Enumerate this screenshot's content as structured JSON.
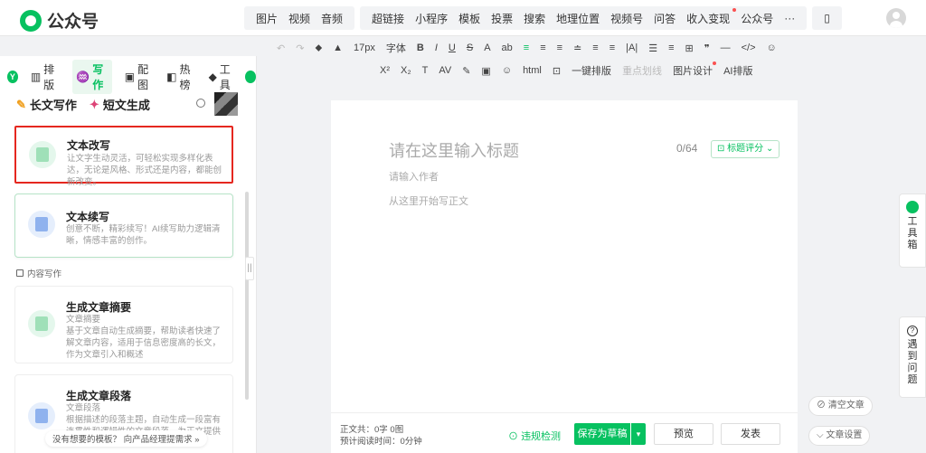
{
  "app": {
    "name": "公众号"
  },
  "top_menu": {
    "group1": [
      "图片",
      "视频",
      "音频"
    ],
    "group2": [
      "超链接",
      "小程序",
      "模板",
      "投票",
      "搜索",
      "地理位置",
      "视频号",
      "问答",
      "收入变现",
      "公众号",
      "···"
    ]
  },
  "toolbar": {
    "row1": [
      "↶",
      "↷",
      "⬥",
      "▲",
      "17px",
      "字体",
      "B",
      "I",
      "U",
      "S",
      "A",
      "ab",
      "≡",
      "≡",
      "≡",
      "≐",
      "≡",
      "≡",
      "|A|",
      "☰",
      "≡",
      "⊞",
      "❞",
      "—",
      "</>",
      "☺"
    ],
    "row2": [
      "X²",
      "X₂",
      "T",
      "AV",
      "✎",
      "▣",
      "☺",
      "html",
      "⊡",
      "一键排版",
      "重点划线",
      "图片设计",
      "AI排版"
    ]
  },
  "sidebar": {
    "tabs": [
      {
        "icon": "Y",
        "label": ""
      },
      {
        "icon": "▥",
        "label": "排版"
      },
      {
        "icon": "♒",
        "label": "写作"
      },
      {
        "icon": "▣",
        "label": "配图"
      },
      {
        "icon": "◧",
        "label": "热榜"
      },
      {
        "icon": "◆",
        "label": "工具"
      }
    ],
    "subnav": [
      "长文写作",
      "短文生成"
    ],
    "section_label": "内容写作",
    "cards": [
      {
        "title": "文本改写",
        "desc": "让文字生动灵活，可轻松实现多样化表达，无论是风格、形式还是内容，都能创新改变。"
      },
      {
        "title": "文本续写",
        "desc": "创意不断，精彩续写！AI续写助力逻辑清晰，情感丰富的创作。"
      },
      {
        "title": "生成文章摘要",
        "desc": "文章摘要\n基于文章自动生成摘要，帮助读者快速了解文章内容，适用于信息密度高的长文，作为文章引入和概述"
      },
      {
        "title": "生成文章段落",
        "desc": "文章段落\n根据描述的段落主题，自动生成一段富有连贯性和逻辑性的文章段落，为正文提供完整内容"
      }
    ],
    "bottom_hint": "没有想要的模板？ 向产品经理提需求 »"
  },
  "editor": {
    "title_placeholder": "请在这里输入标题",
    "title_count": "0/64",
    "title_score": "标题评分",
    "author_placeholder": "请输入作者",
    "body_placeholder": "从这里开始写正文"
  },
  "footer": {
    "stats_line1": "正文共：0字 0图",
    "stats_line2": "预计阅读时间：0分钟",
    "check": "违规检测",
    "save": "保存为草稿",
    "preview": "预览",
    "publish": "发表"
  },
  "side_tools": {
    "toolbox": "工具箱",
    "help": "遇到问题"
  },
  "float_buttons": {
    "clear": "清空文章",
    "settings": "文章设置"
  }
}
